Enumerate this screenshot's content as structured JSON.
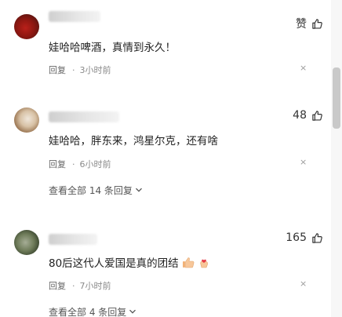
{
  "comments": [
    {
      "like_text": "赞",
      "content": "娃哈哈啤酒，真情到永久！",
      "reply_label": "回复",
      "time": "3小时前",
      "more": "×"
    },
    {
      "like_text": "48",
      "content": "娃哈哈，胖东来，鸿星尔克，还有啥",
      "reply_label": "回复",
      "time": "6小时前",
      "more": "×",
      "view_all": "查看全部 14 条回复"
    },
    {
      "like_text": "165",
      "content": "80后这代人爱国是真的团结",
      "reply_label": "回复",
      "time": "7小时前",
      "more": "×",
      "view_all": "查看全部 4 条回复"
    }
  ],
  "colors": {
    "text": "#1f1f1f",
    "meta": "#8a8a8a",
    "scroll_thumb": "#c9c9c9"
  },
  "icons": {
    "like": "thumbs-up-icon",
    "expand": "chevron-down-icon",
    "close": "close-icon"
  }
}
